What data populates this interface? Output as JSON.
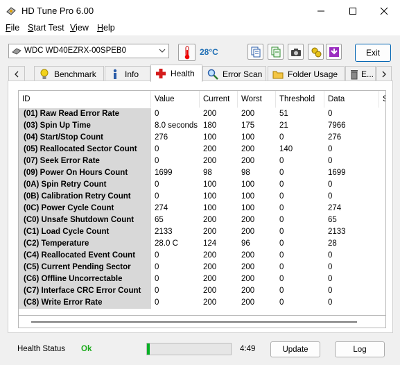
{
  "window": {
    "title": "HD Tune Pro 6.00"
  },
  "menu": [
    {
      "label": "File",
      "u": "F",
      "rest": "ile"
    },
    {
      "label": "Start Test",
      "u": "S",
      "rest": "tart Test"
    },
    {
      "label": "View",
      "u": "V",
      "rest": "iew"
    },
    {
      "label": "Help",
      "u": "H",
      "rest": "elp"
    }
  ],
  "toolbar": {
    "drive": "WDC WD40EZRX-00SPEB0",
    "temperature": "28°C",
    "exit_label": "Exit",
    "exit_underline": "x"
  },
  "tabs": [
    {
      "label": "Benchmark",
      "icon": "lightbulb-icon"
    },
    {
      "label": "Info",
      "icon": "info-icon"
    },
    {
      "label": "Health",
      "icon": "health-cross-icon",
      "active": true
    },
    {
      "label": "Error Scan",
      "icon": "magnifier-icon"
    },
    {
      "label": "Folder Usage",
      "icon": "folder-icon"
    },
    {
      "label": "E...",
      "icon": "trash-icon"
    }
  ],
  "table": {
    "columns": [
      "ID",
      "Value",
      "Current",
      "Worst",
      "Threshold",
      "Data",
      "S"
    ],
    "rows": [
      [
        "(01) Raw Read Error Rate",
        "0",
        "200",
        "200",
        "51",
        "0"
      ],
      [
        "(03) Spin Up Time",
        "8.0 seconds",
        "180",
        "175",
        "21",
        "7966"
      ],
      [
        "(04) Start/Stop Count",
        "276",
        "100",
        "100",
        "0",
        "276"
      ],
      [
        "(05) Reallocated Sector Count",
        "0",
        "200",
        "200",
        "140",
        "0"
      ],
      [
        "(07) Seek Error Rate",
        "0",
        "200",
        "200",
        "0",
        "0"
      ],
      [
        "(09) Power On Hours Count",
        "1699",
        "98",
        "98",
        "0",
        "1699"
      ],
      [
        "(0A) Spin Retry Count",
        "0",
        "100",
        "100",
        "0",
        "0"
      ],
      [
        "(0B) Calibration Retry Count",
        "0",
        "100",
        "100",
        "0",
        "0"
      ],
      [
        "(0C) Power Cycle Count",
        "274",
        "100",
        "100",
        "0",
        "274"
      ],
      [
        "(C0) Unsafe Shutdown Count",
        "65",
        "200",
        "200",
        "0",
        "65"
      ],
      [
        "(C1) Load Cycle Count",
        "2133",
        "200",
        "200",
        "0",
        "2133"
      ],
      [
        "(C2) Temperature",
        "28.0 C",
        "124",
        "96",
        "0",
        "28"
      ],
      [
        "(C4) Reallocated Event Count",
        "0",
        "200",
        "200",
        "0",
        "0"
      ],
      [
        "(C5) Current Pending Sector",
        "0",
        "200",
        "200",
        "0",
        "0"
      ],
      [
        "(C6) Offline Uncorrectable",
        "0",
        "200",
        "200",
        "0",
        "0"
      ],
      [
        "(C7) Interface CRC Error Count",
        "0",
        "200",
        "200",
        "0",
        "0"
      ],
      [
        "(C8) Write Error Rate",
        "0",
        "200",
        "200",
        "0",
        "0"
      ]
    ]
  },
  "status": {
    "label": "Health Status",
    "value": "Ok",
    "progress": 0.03,
    "time": "4:49",
    "update_label": "Update",
    "log_label": "Log"
  },
  "colors": {
    "ok": "#1cab1c",
    "temperature": "#1f6fb5",
    "progress": "#06b025"
  }
}
